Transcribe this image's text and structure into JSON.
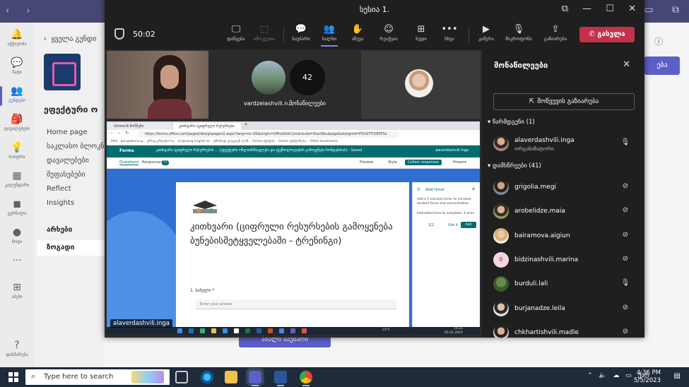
{
  "meeting": {
    "title": "სესია 1.",
    "timer": "50:02",
    "toolbar": [
      {
        "icon": "screen-icon",
        "glyph": "🖵",
        "label": "დაწყება",
        "dim": false
      },
      {
        "icon": "screenshare-off-icon",
        "glyph": "⬚",
        "label": "ამოკვეთა",
        "dim": true
      },
      {
        "icon": "chat-icon",
        "glyph": "💬",
        "label": "საუბარი",
        "dim": false
      },
      {
        "icon": "people-icon",
        "glyph": "👥",
        "label": "ხალხი",
        "dim": false,
        "active": true
      },
      {
        "icon": "raise-hand-icon",
        "glyph": "✋",
        "label": "აწევა",
        "dim": false
      },
      {
        "icon": "reactions-icon",
        "glyph": "☺",
        "label": "რეაქცია",
        "dim": false
      },
      {
        "icon": "view-icon",
        "glyph": "⊞",
        "label": "ხედი",
        "dim": false
      },
      {
        "icon": "more-icon",
        "glyph": "•••",
        "label": "სხვა",
        "dim": false
      },
      {
        "icon": "camera-off-icon",
        "glyph": "▶",
        "label": "კამერა",
        "dim": false
      },
      {
        "icon": "mic-off-icon",
        "glyph": "🎙",
        "label": "მიკროფონი",
        "dim": false
      },
      {
        "icon": "share-icon",
        "glyph": "⇪",
        "label": "გაზიარება",
        "dim": false
      }
    ],
    "leave_label": "გასვლა",
    "participants_count": "42",
    "participants_count_label": "მონაწილეები",
    "avatar_tile_name": "vardzelashvili.n...",
    "presenter_name": "alaverdashvili.inga"
  },
  "shared_screen": {
    "tabs": [
      "Online-B მოწმენი",
      "კითხვარი (ციფრული რესურსები"
    ],
    "url": "https://forms.office.com/pages/designpagev2.aspx?lang=en-US&origin=OfficeDotCom&route=StartBoulpage&designId=POnSYTiOE0FSx",
    "bookmarks": "Mail - gon@ebenu.g...   უძრაყ ვრდებთ ხა...   Lingvanig English w...   ებნარად   გოგგაგნ ლიმ...   Online ტესტის...   Online ტესტირება...   Other bookmarks",
    "forms_app": "Forms",
    "forms_doc": "კითხვარი (ციფრული რესურსების ... (ეფექტური ონლაინსწავლება და ტექნოლოგიების გამოყენება ზონდებისას) - Saved",
    "forms_user": "alaverdashvili inga",
    "tab_questions": "Questions",
    "tab_responses": "Responses",
    "responses_count": "77",
    "preview": "Preview",
    "style": "Style",
    "collect": "Collect responses",
    "present": "Present",
    "form_title": "კითხვარი (ციფრული რესურსების გამოყენება ბუნებისმეტყველებაში - ტრენინგი)",
    "question": "1. სახელი *",
    "answer_placeholder": "Enter your answer",
    "timer_panel": {
      "title": "Add timer",
      "text": "Add a 5 minutes timer to increase student focus and concentration.",
      "estimate": "Estimated time to complete: 3 mins",
      "page": "1/2",
      "got_it": "Got it",
      "add": "Add"
    },
    "taskbar_weather": "23°C",
    "taskbar_time": "16:23",
    "taskbar_date": "05.05.2023"
  },
  "participants_panel": {
    "title": "მონაწილეები",
    "share_invite": "მოწვევის გაზიარება",
    "organizers_label": "წარმდგენი (1)",
    "attendees_label": "დამსწრეები (41)",
    "organizer": {
      "name": "alaverdashvili.inga",
      "role": "ორგანიზატორი",
      "mic": "on"
    },
    "attendees": [
      {
        "name": "grigolia.megi",
        "mic": "off",
        "initial": ""
      },
      {
        "name": "arobelidze.maia",
        "mic": "off",
        "initial": ""
      },
      {
        "name": "bairamova.aigiun",
        "mic": "off",
        "initial": ""
      },
      {
        "name": "bidzinashvili.marina",
        "mic": "off",
        "initial": "B"
      },
      {
        "name": "burduli.lali",
        "mic": "on",
        "initial": ""
      },
      {
        "name": "burjanadze.leila",
        "mic": "off",
        "initial": ""
      },
      {
        "name": "chkhartishvili.madle",
        "mic": "off",
        "initial": ""
      }
    ]
  },
  "teams": {
    "rail": [
      {
        "icon": "bell-icon",
        "glyph": "🔔",
        "label": "აქტივობა"
      },
      {
        "icon": "chat-icon",
        "glyph": "💬",
        "label": "ჩატი"
      },
      {
        "icon": "teams-icon",
        "glyph": "👥",
        "label": "გუნდები",
        "active": true
      },
      {
        "icon": "assignments-icon",
        "glyph": "🎒",
        "label": "დავალებები"
      },
      {
        "icon": "insights-icon",
        "glyph": "💡",
        "label": "Insights"
      },
      {
        "icon": "calendar-icon",
        "glyph": "▦",
        "label": "კალენდარი"
      },
      {
        "icon": "reflect-icon",
        "glyph": "◼",
        "label": "ჟურნალი"
      },
      {
        "icon": "app-icon",
        "glyph": "●",
        "label": "ნოტა"
      },
      {
        "icon": "more-icon",
        "glyph": "···",
        "label": ""
      },
      {
        "icon": "apps-icon",
        "glyph": "⊞",
        "label": "აპები"
      },
      {
        "icon": "help-icon",
        "glyph": "?",
        "label": "დახმარება"
      }
    ],
    "back_label": "ყველა გუნდი",
    "team_name": "ეფექტური ო",
    "links": [
      "Home page",
      "საკლასო ბლოკნ",
      "დავალებები",
      "შეფასებები",
      "Reflect",
      "Insights"
    ],
    "section_label": "არხები",
    "channel_general": "ზოგადი",
    "new_conversation": "ახალი საუბარი",
    "right_cta": "ება"
  },
  "windows": {
    "search_placeholder": "Type here to search",
    "time": "4:36 PM",
    "date": "5/5/2023",
    "lang": "ქარ"
  }
}
